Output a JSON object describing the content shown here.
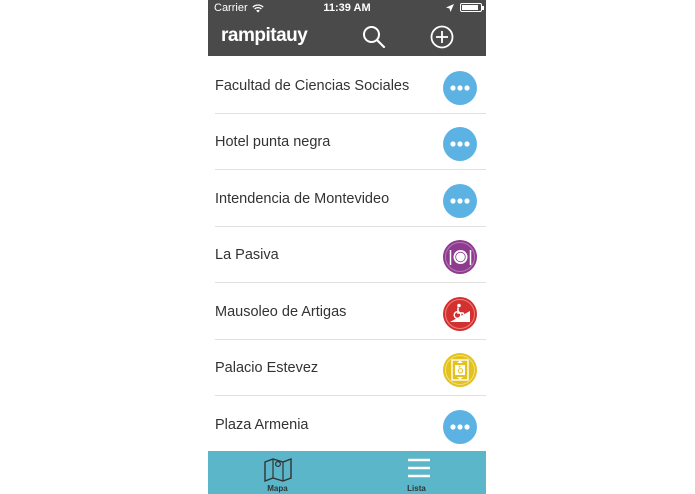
{
  "status_bar": {
    "carrier": "Carrier",
    "time": "11:39 AM",
    "battery_level": 0.9
  },
  "nav_bar": {
    "logo": "rampitauy",
    "icons": [
      "search-icon",
      "add-circle-icon"
    ]
  },
  "list": {
    "items": [
      {
        "label": "Facultad de Ciencias Sociales",
        "icon": "more-icon",
        "color": "#5cb3e3"
      },
      {
        "label": "Hotel punta negra",
        "icon": "more-icon",
        "color": "#5cb3e3"
      },
      {
        "label": "Intendencia de Montevideo",
        "icon": "more-icon",
        "color": "#5cb3e3"
      },
      {
        "label": "La Pasiva",
        "icon": "restaurant-icon",
        "color": "#8e3b8f"
      },
      {
        "label": "Mausoleo de Artigas",
        "icon": "wheelchair-ramp-icon",
        "color": "#d3312f"
      },
      {
        "label": "Palacio Estevez",
        "icon": "accessible-elevator-icon",
        "color": "#e4c21d"
      },
      {
        "label": "Plaza Armenia",
        "icon": "more-icon",
        "color": "#5cb3e3"
      }
    ]
  },
  "tab_bar": {
    "tabs": [
      {
        "label": "Mapa",
        "icon": "map-icon"
      },
      {
        "label": "Lista",
        "icon": "list-icon"
      }
    ]
  },
  "colors": {
    "header_bg": "#4a4a4a",
    "tab_bar_bg": "#5bb6c9"
  }
}
